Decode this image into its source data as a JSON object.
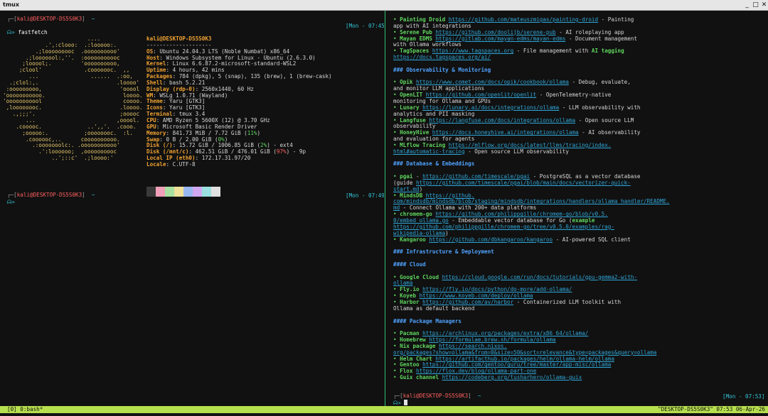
{
  "window": {
    "title": "tmux",
    "minimize": "_",
    "maximize": "□",
    "close": "✕"
  },
  "left": {
    "prompt1": {
      "user": "kali@DESKTOP-DS5S0K3",
      "time": "[Mon - 07:45]",
      "command": "fastfetch"
    },
    "logo": [
      "                          ....",
      "             .',:clooo:  .:looooo:.",
      "          .;looooooooc  .oooooooooo'",
      "       .;looooool:,''.  :ooooooooooc",
      "      ;looool;.         'oooooooooo,",
      "     ;clool'             .cooooooc.  ,,",
      "        ...                ......  .:oo,",
      "  .;clol:,.                        .loooo'",
      " :ooooooooo,                        'ooool",
      "'ooooooooooo.                        loooo.",
      "'ooooooooool                         coooo.",
      " ,loooooooc.                        .loooo.",
      "   .,;;;'.                          ;ooooc",
      "       ...                         ,ooool.",
      "    .cooooc.              ..',,'.  .cooo.",
      "      ;ooooo:.           ;oooooooc.  :l.",
      "       .coooooc,..      coooooooooo.",
      "         .:ooooooolc:. .ooooooooooo'",
      "           .':loooooo;  ,oooooooooc",
      "               ..';::c'  .;loooo:'"
    ],
    "info_header": "kali@DESKTOP-DS5S0K3",
    "info_sep": "--------------------",
    "info": [
      {
        "label": "OS",
        "value": "Ubuntu 24.04.3 LTS (Noble Numbat) x86_64"
      },
      {
        "label": "Host",
        "value": "Windows Subsystem for Linux - Ubuntu (2.6.3.0)"
      },
      {
        "label": "Kernel",
        "value": "Linux 6.6.87.2-microsoft-standard-WSL2"
      },
      {
        "label": "Uptime",
        "value": "4 hours, 42 mins"
      },
      {
        "label": "Packages",
        "value": "784 (dpkg), 5 (snap), 135 (brew), 1 (brew-cask)"
      },
      {
        "label": "Shell",
        "value": "bash 5.2.21"
      },
      {
        "label": "Display (rdp-0)",
        "value": "2560x1440, 60 Hz"
      },
      {
        "label": "WM",
        "value": "WSLg 1.0.71 (Wayland)"
      },
      {
        "label": "Theme",
        "value": "Yaru [GTK3]"
      },
      {
        "label": "Icons",
        "value": "Yaru [GTK3]"
      },
      {
        "label": "Terminal",
        "value": "tmux 3.4"
      },
      {
        "label": "CPU",
        "value": "AMD Ryzen 5 5600X (12) @ 3.70 GHz"
      },
      {
        "label": "GPU",
        "value": "Microsoft Basic Render Driver"
      },
      {
        "label": "Memory",
        "value": "841.73 MiB / 7.72 GiB (",
        "pct": "11%",
        "suffix": ")"
      },
      {
        "label": "Swap",
        "value": "0 B / 2.00 GiB (",
        "pct": "0%",
        "suffix": ")"
      },
      {
        "label": "Disk (/)",
        "value": "15.72 GiB / 1006.85 GiB (",
        "pct": "2%",
        "suffix": ") - ext4"
      },
      {
        "label": "Disk (/mnt/c)",
        "value": "462.51 GiB / 476.01 GiB (",
        "pct": "97%",
        "suffix": ") - 9p"
      },
      {
        "label": "Local IP (eth0)",
        "value": "172.17.31.97/20"
      },
      {
        "label": "Locale",
        "value": "C.UTF-8"
      }
    ],
    "swatches": [
      "#3a3a3a",
      "#f0a0b8",
      "#a8e0a0",
      "#f0e09a",
      "#9ab8f0",
      "#d0a8f0",
      "#9ae0e0",
      "#e0e0e0"
    ],
    "prompt2": {
      "user": "kali@DESKTOP-DS5S0K3",
      "time": "[Mon - 07:49]"
    }
  },
  "right": {
    "lines": [
      [
        {
          "t": "• ",
          "c": "green"
        },
        {
          "t": "Painting Droid",
          "c": "green bold"
        },
        {
          "t": " "
        },
        {
          "t": "https://github.com/mateuszmigas/painting-droid",
          "c": "link"
        },
        {
          "t": " - Painting"
        }
      ],
      [
        {
          "t": "app with AI integrations"
        }
      ],
      [
        {
          "t": "• ",
          "c": "green"
        },
        {
          "t": "Serene Pub",
          "c": "green bold"
        },
        {
          "t": " "
        },
        {
          "t": "https://github.com/doolijb/serene-pub",
          "c": "link"
        },
        {
          "t": " - AI roleplaying app"
        }
      ],
      [
        {
          "t": "• ",
          "c": "green"
        },
        {
          "t": "Mayan EDMS",
          "c": "green bold"
        },
        {
          "t": " "
        },
        {
          "t": "https://gitlab.com/mayan-edms/mayan-edms",
          "c": "link"
        },
        {
          "t": " - Document management"
        }
      ],
      [
        {
          "t": "with Ollama workflows"
        }
      ],
      [
        {
          "t": "• ",
          "c": "green"
        },
        {
          "t": "TagSpaces",
          "c": "green bold"
        },
        {
          "t": " "
        },
        {
          "t": "https://www.tagspaces.org",
          "c": "link"
        },
        {
          "t": " - File management with "
        },
        {
          "t": "AI tagging",
          "c": "green bold"
        }
      ],
      [
        {
          "t": "https://docs.tagspaces.org/ai/",
          "c": "link"
        }
      ],
      [],
      [
        {
          "t": "### Observability & Monitoring",
          "c": "blue bold"
        }
      ],
      [],
      [
        {
          "t": "• ",
          "c": "green"
        },
        {
          "t": "Opik",
          "c": "green bold"
        },
        {
          "t": " "
        },
        {
          "t": "https://www.comet.com/docs/opik/cookbook/ollama",
          "c": "link"
        },
        {
          "t": " - Debug, evaluate,"
        }
      ],
      [
        {
          "t": "and monitor LLM applications"
        }
      ],
      [
        {
          "t": "• ",
          "c": "green"
        },
        {
          "t": "OpenLIT",
          "c": "green bold"
        },
        {
          "t": " "
        },
        {
          "t": "https://github.com/openlit/openlit",
          "c": "link"
        },
        {
          "t": " - OpenTelemetry-native"
        }
      ],
      [
        {
          "t": "monitoring for Ollama and GPUs"
        }
      ],
      [
        {
          "t": "• ",
          "c": "green"
        },
        {
          "t": "Lunary",
          "c": "green bold"
        },
        {
          "t": " "
        },
        {
          "t": "https://lunary.ai/docs/integrations/ollama",
          "c": "link"
        },
        {
          "t": " - LLM observability with"
        }
      ],
      [
        {
          "t": "analytics and PII masking"
        }
      ],
      [
        {
          "t": "• ",
          "c": "green"
        },
        {
          "t": "Langfuse",
          "c": "green bold"
        },
        {
          "t": " "
        },
        {
          "t": "https://langfuse.com/docs/integrations/ollama",
          "c": "link"
        },
        {
          "t": " - Open source LLM"
        }
      ],
      [
        {
          "t": "observability"
        }
      ],
      [
        {
          "t": "• ",
          "c": "green"
        },
        {
          "t": "HoneyHive",
          "c": "green bold"
        },
        {
          "t": " "
        },
        {
          "t": "https://docs.honeyhive.ai/integrations/ollama",
          "c": "link"
        },
        {
          "t": " - AI observability"
        }
      ],
      [
        {
          "t": "and evaluation for agents"
        }
      ],
      [
        {
          "t": "• ",
          "c": "green"
        },
        {
          "t": "MLflow Tracing",
          "c": "green bold"
        },
        {
          "t": " "
        },
        {
          "t": "https://mlflow.org/docs/latest/llms/tracing/index.",
          "c": "link"
        }
      ],
      [
        {
          "t": "html#automatic-tracing",
          "c": "link"
        },
        {
          "t": " - Open source LLM observability"
        }
      ],
      [],
      [
        {
          "t": "### Database & Embeddings",
          "c": "blue bold"
        }
      ],
      [],
      [
        {
          "t": "• ",
          "c": "green"
        },
        {
          "t": "pgai",
          "c": "green bold"
        },
        {
          "t": " - "
        },
        {
          "t": "https://github.com/timescale/pgai",
          "c": "link"
        },
        {
          "t": " - PostgreSQL as a vector database"
        }
      ],
      [
        {
          "t": "(guide "
        },
        {
          "t": "https://github.com/timescale/pgai/blob/main/docs/vectorizer-quick-",
          "c": "link"
        }
      ],
      [
        {
          "t": "start.md",
          "c": "link"
        },
        {
          "t": ")"
        }
      ],
      [
        {
          "t": "• ",
          "c": "green"
        },
        {
          "t": "MindsDB",
          "c": "green bold"
        },
        {
          "t": " "
        },
        {
          "t": "https://github.",
          "c": "link"
        }
      ],
      [
        {
          "t": "com/mindsdb/mindsdb/blob/staging/mindsdb/integrations/handlers/ollama_handler/README.",
          "c": "link"
        }
      ],
      [
        {
          "t": "md",
          "c": "link"
        },
        {
          "t": " - Connect Ollama with 200+ data platforms"
        }
      ],
      [
        {
          "t": "• ",
          "c": "green"
        },
        {
          "t": "chromem-go",
          "c": "green bold"
        },
        {
          "t": " "
        },
        {
          "t": "https://github.com/philippgille/chromem-go/blob/v0.5.",
          "c": "link"
        }
      ],
      [
        {
          "t": "0/embed_ollama.go",
          "c": "link"
        },
        {
          "t": " - Embeddable vector database for Go ("
        },
        {
          "t": "example",
          "c": "green bold"
        }
      ],
      [
        {
          "t": "https://github.com/philippgille/chromem-go/tree/v0.5.0/examples/rag-",
          "c": "link"
        }
      ],
      [
        {
          "t": "wikipedia-ollama",
          "c": "link"
        },
        {
          "t": ")"
        }
      ],
      [
        {
          "t": "• ",
          "c": "green"
        },
        {
          "t": "Kangaroo",
          "c": "green bold"
        },
        {
          "t": " "
        },
        {
          "t": "https://github.com/dbkangaroo/kangaroo",
          "c": "link"
        },
        {
          "t": " - AI-powered SQL client"
        }
      ],
      [],
      [
        {
          "t": "### Infrastructure & Deployment",
          "c": "blue bold"
        }
      ],
      [],
      [
        {
          "t": "#### Cloud",
          "c": "blue bold"
        }
      ],
      [],
      [
        {
          "t": "• ",
          "c": "green"
        },
        {
          "t": "Google Cloud",
          "c": "green bold"
        },
        {
          "t": " "
        },
        {
          "t": "https://cloud.google.com/run/docs/tutorials/gpu-gemma2-with-",
          "c": "link"
        }
      ],
      [
        {
          "t": "ollama",
          "c": "link"
        }
      ],
      [
        {
          "t": "• ",
          "c": "green"
        },
        {
          "t": "Fly.io",
          "c": "green bold"
        },
        {
          "t": " "
        },
        {
          "t": "https://fly.io/docs/python/do-more/add-ollama/",
          "c": "link"
        }
      ],
      [
        {
          "t": "• ",
          "c": "green"
        },
        {
          "t": "Koyeb",
          "c": "green bold"
        },
        {
          "t": " "
        },
        {
          "t": "https://www.koyeb.com/deploy/ollama",
          "c": "link"
        }
      ],
      [
        {
          "t": "• ",
          "c": "green"
        },
        {
          "t": "Harbor",
          "c": "green bold"
        },
        {
          "t": " "
        },
        {
          "t": "https://github.com/av/harbor",
          "c": "link"
        },
        {
          "t": " - Containerized LLM toolkit with"
        }
      ],
      [
        {
          "t": "Ollama as default backend"
        }
      ],
      [],
      [
        {
          "t": "#### Package Managers",
          "c": "blue bold"
        }
      ],
      [],
      [
        {
          "t": "• ",
          "c": "green"
        },
        {
          "t": "Pacman",
          "c": "green bold"
        },
        {
          "t": " "
        },
        {
          "t": "https://archlinux.org/packages/extra/x86_64/ollama/",
          "c": "link"
        }
      ],
      [
        {
          "t": "• ",
          "c": "green"
        },
        {
          "t": "Homebrew",
          "c": "green bold"
        },
        {
          "t": " "
        },
        {
          "t": "https://formulae.brew.sh/formula/ollama",
          "c": "link"
        }
      ],
      [
        {
          "t": "• ",
          "c": "green"
        },
        {
          "t": "Nix package",
          "c": "green bold"
        },
        {
          "t": " "
        },
        {
          "t": "https://search.nixos.",
          "c": "link"
        }
      ],
      [
        {
          "t": "org/packages?show=ollama&from=0&size=50&sort=relevance&type=packages&query=ollama",
          "c": "link"
        }
      ],
      [
        {
          "t": "• ",
          "c": "green"
        },
        {
          "t": "Helm Chart",
          "c": "green bold"
        },
        {
          "t": " "
        },
        {
          "t": "https://artifacthub.io/packages/helm/ollama-helm/ollama",
          "c": "link"
        }
      ],
      [
        {
          "t": "• ",
          "c": "green"
        },
        {
          "t": "Gentoo",
          "c": "green bold"
        },
        {
          "t": " "
        },
        {
          "t": "https://github.com/gentoo/guru/tree/master/app-misc/ollama",
          "c": "link"
        }
      ],
      [
        {
          "t": "• ",
          "c": "green"
        },
        {
          "t": "Flox",
          "c": "green bold"
        },
        {
          "t": " "
        },
        {
          "t": "https://flox.dev/blog/ollama-part-one",
          "c": "link"
        }
      ],
      [
        {
          "t": "• ",
          "c": "green"
        },
        {
          "t": "Guix channel",
          "c": "green bold"
        },
        {
          "t": " "
        },
        {
          "t": "https://codeberg.org/tusharhero/ollama-guix",
          "c": "link"
        }
      ]
    ],
    "prompt": {
      "user": "kali@DESKTOP-DS5S0K3",
      "time": "[Mon - 07:53]"
    }
  },
  "status": {
    "left": "[0] 0:bash*",
    "right": "\"DESKTOP-DS5S0K3\" 07:53 06-Apr-26"
  },
  "glyphs": {
    "corner": "┌─",
    "prompt_arrow": "»",
    "tilde": "~",
    "ghost": "ᗣ"
  }
}
